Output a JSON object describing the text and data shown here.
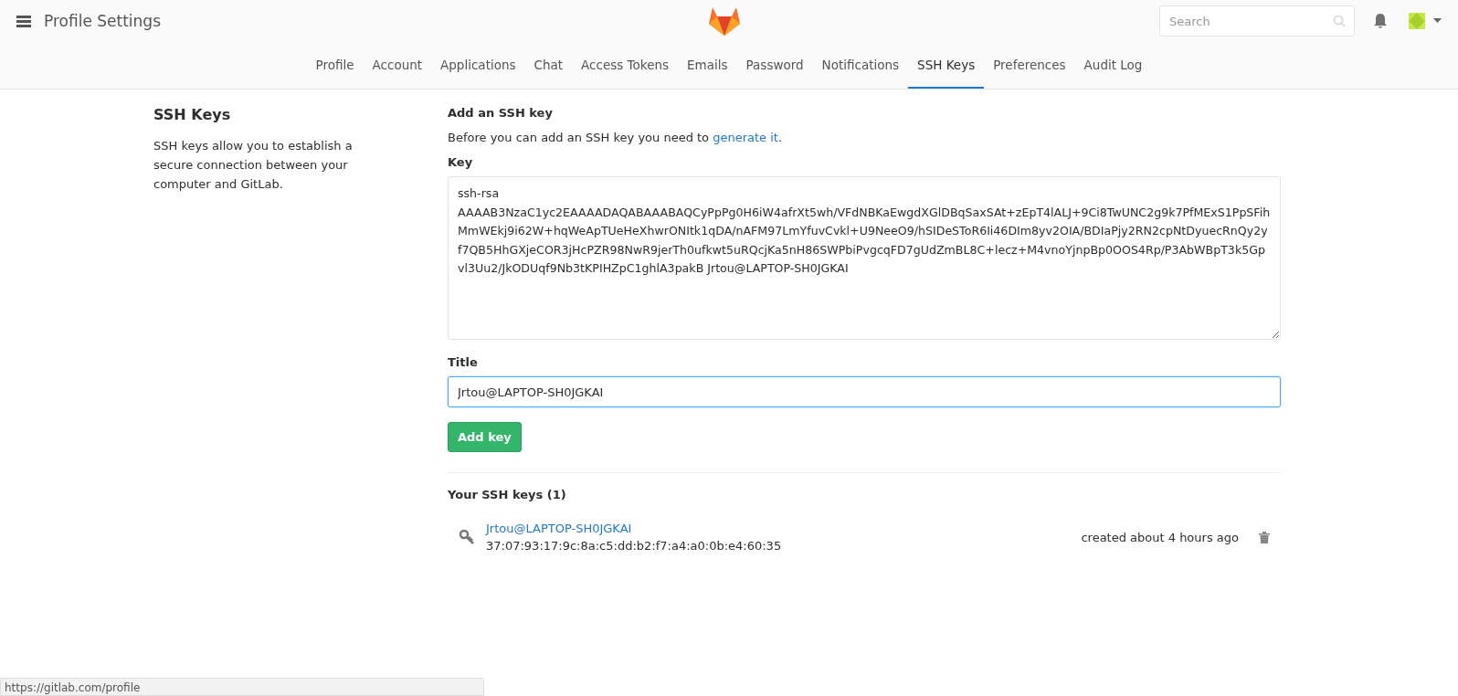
{
  "header": {
    "title": "Profile Settings",
    "search": {
      "placeholder": "Search"
    }
  },
  "tabs": [
    {
      "label": "Profile",
      "selected": false
    },
    {
      "label": "Account",
      "selected": false
    },
    {
      "label": "Applications",
      "selected": false
    },
    {
      "label": "Chat",
      "selected": false
    },
    {
      "label": "Access Tokens",
      "selected": false
    },
    {
      "label": "Emails",
      "selected": false
    },
    {
      "label": "Password",
      "selected": false
    },
    {
      "label": "Notifications",
      "selected": false
    },
    {
      "label": "SSH Keys",
      "selected": true
    },
    {
      "label": "Preferences",
      "selected": false
    },
    {
      "label": "Audit Log",
      "selected": false
    }
  ],
  "sidebar": {
    "title": "SSH Keys",
    "description": "SSH keys allow you to establish a secure connection between your computer and GitLab."
  },
  "form": {
    "heading": "Add an SSH key",
    "intro": "Before you can add an SSH key you need to",
    "intro_link": "generate it",
    "intro_end": ".",
    "key_label": "Key",
    "key_value": "ssh-rsa AAAAB3NzaC1yc2EAAAADAQABAAABAQCyPpPg0H6iW4afrXt5wh/VFdNBKaEwgdXGlDBqSaxSAt+zEpT4lALJ+9Ci8TwUNC2g9k7PfMExS1PpSFihMmWEkj9i62W+hqWeApTUeHeXhwrONItk1qDA/nAFM97LmYfuvCvkl+U9NeeO9/hSIDeSToR6Ii46DIm8yv2OIA/BDIaPjy2RN2cpNtDyuecRnQy2yf7QB5HhGXjeCOR3jHcPZR98NwR9jerTh0ufkwt5uRQcjKa5nH86SWPbiPvgcqFD7gUdZmBL8C+lecz+M4vnoYjnpBp0OOS4Rp/P3AbWBpT3k5Gpvl3Uu2/JkODUqf9Nb3tKPIHZpC1ghlA3pakB Jrtou@LAPTOP-SH0JGKAI",
    "title_label": "Title",
    "title_value": "Jrtou@LAPTOP-SH0JGKAI",
    "submit": "Add key"
  },
  "keys": {
    "heading": "Your SSH keys (1)",
    "items": [
      {
        "title": "Jrtou@LAPTOP-SH0JGKAI",
        "fingerprint": "37:07:93:17:9c:8a:c5:dd:b2:f7:a4:a0:0b:e4:60:35",
        "created": "created about 4 hours ago"
      }
    ]
  },
  "status_bar": {
    "url": "https://gitlab.com/profile"
  }
}
